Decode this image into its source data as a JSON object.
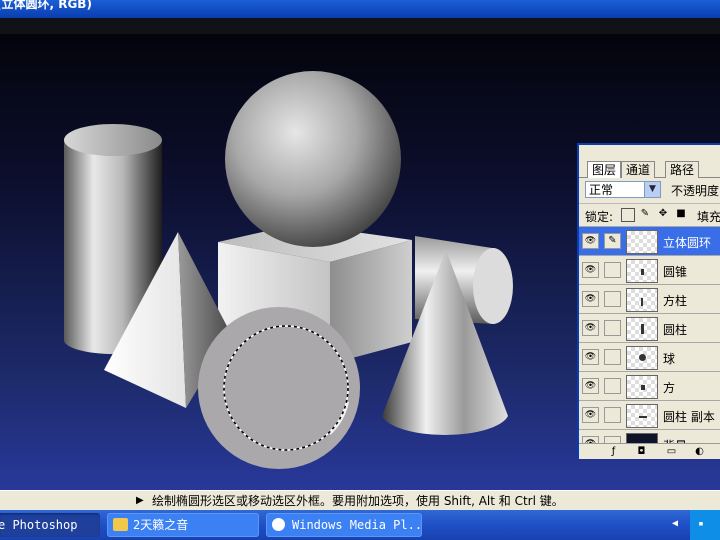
{
  "window": {
    "title": "(立体圆环, RGB)"
  },
  "layers_panel": {
    "tabs": [
      "图层",
      "通道",
      "路径"
    ],
    "blend_mode": "正常",
    "opacity_label": "不透明度:",
    "lock_label": "锁定:",
    "fill_label": "填充:",
    "layers": [
      {
        "name": "立体圆环",
        "selected": true
      },
      {
        "name": "圆锥",
        "selected": false
      },
      {
        "name": "方柱",
        "selected": false
      },
      {
        "name": "圆柱",
        "selected": false
      },
      {
        "name": "球",
        "selected": false
      },
      {
        "name": "方",
        "selected": false
      },
      {
        "name": "圆柱 副本",
        "selected": false
      },
      {
        "name": "背景",
        "selected": false
      }
    ]
  },
  "status_bar": {
    "text": "绘制椭圆形选区或移动选区外框。要用附加选项，使用 Shift, Alt 和 Ctrl 键。"
  },
  "taskbar": {
    "items": [
      {
        "label": "e Photoshop",
        "icon": "photoshop-icon"
      },
      {
        "label": "2天籁之音",
        "icon": "folder-icon"
      },
      {
        "label": "Windows Media Pl...",
        "icon": "media-player-icon"
      }
    ]
  },
  "colors": {
    "selected_layer": "#3a6ee8",
    "xp_blue": "#0a3db0"
  }
}
